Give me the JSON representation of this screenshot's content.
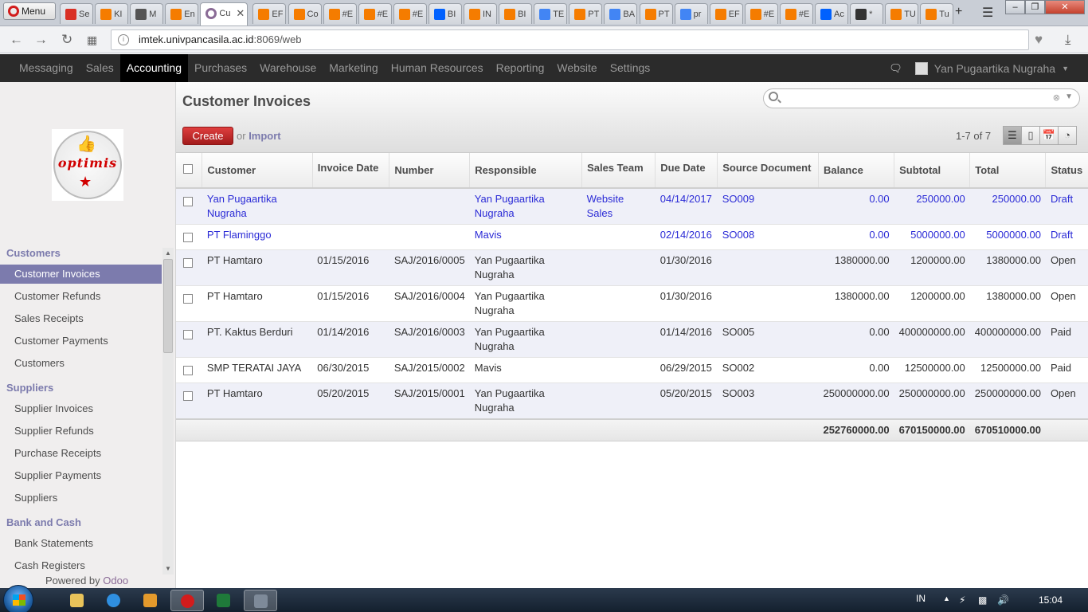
{
  "browser": {
    "menu_label": "Menu",
    "tabs": [
      {
        "label": "Se",
        "color": "#d93025"
      },
      {
        "label": "KI",
        "color": "#f57c00"
      },
      {
        "label": "M",
        "color": "#555555"
      },
      {
        "label": "En",
        "color": "#f57c00"
      },
      {
        "label": "Cu",
        "color": "#8a6b96"
      },
      {
        "label": "EF",
        "color": "#f57c00"
      },
      {
        "label": "Co",
        "color": "#f57c00"
      },
      {
        "label": "#E",
        "color": "#f57c00"
      },
      {
        "label": "#E",
        "color": "#f57c00"
      },
      {
        "label": "#E",
        "color": "#f57c00"
      },
      {
        "label": "BI",
        "color": "#0061fe"
      },
      {
        "label": "IN",
        "color": "#f57c00"
      },
      {
        "label": "BI",
        "color": "#f57c00"
      },
      {
        "label": "TE",
        "color": "#4285f4"
      },
      {
        "label": "PT",
        "color": "#f57c00"
      },
      {
        "label": "BA",
        "color": "#4285f4"
      },
      {
        "label": "PT",
        "color": "#f57c00"
      },
      {
        "label": "pr",
        "color": "#4285f4"
      },
      {
        "label": "EF",
        "color": "#f57c00"
      },
      {
        "label": "#E",
        "color": "#f57c00"
      },
      {
        "label": "#E",
        "color": "#f57c00"
      },
      {
        "label": "Ac",
        "color": "#0061fe"
      },
      {
        "label": "*",
        "color": "#333333"
      },
      {
        "label": "TU",
        "color": "#f57c00"
      },
      {
        "label": "Tu",
        "color": "#f57c00"
      }
    ],
    "url_host": "imtek.univpancasila.ac.id",
    "url_rest": ":8069/web"
  },
  "topnav": {
    "items": [
      "Messaging",
      "Sales",
      "Accounting",
      "Purchases",
      "Warehouse",
      "Marketing",
      "Human Resources",
      "Reporting",
      "Website",
      "Settings"
    ],
    "active": "Accounting",
    "user_name": "Yan Pugaartika Nugraha"
  },
  "sidebar": {
    "sections": [
      {
        "title": "Customers",
        "items": [
          "Customer Invoices",
          "Customer Refunds",
          "Sales Receipts",
          "Customer Payments",
          "Customers"
        ]
      },
      {
        "title": "Suppliers",
        "items": [
          "Supplier Invoices",
          "Supplier Refunds",
          "Purchase Receipts",
          "Supplier Payments",
          "Suppliers"
        ]
      },
      {
        "title": "Bank and Cash",
        "items": [
          "Bank Statements",
          "Cash Registers"
        ]
      }
    ],
    "active_item": "Customer Invoices",
    "powered_by": "Powered by",
    "powered_brand": "Odoo"
  },
  "main": {
    "title": "Customer Invoices",
    "search_placeholder": "",
    "create_label": "Create",
    "or_label": "or",
    "import_label": "Import",
    "pager": "1-7 of 7",
    "columns": [
      "Customer",
      "Invoice Date",
      "Number",
      "Responsible",
      "Sales Team",
      "Due Date",
      "Source Document",
      "Balance",
      "Subtotal",
      "Total",
      "Status"
    ],
    "rows": [
      {
        "customer": "Yan Pugaartika Nugraha",
        "invoice_date": "",
        "number": "",
        "responsible": "Yan Pugaartika Nugraha",
        "sales_team": "Website Sales",
        "due_date": "04/14/2017",
        "source": "SO009",
        "balance": "0.00",
        "subtotal": "250000.00",
        "total": "250000.00",
        "status": "Draft"
      },
      {
        "customer": "PT Flaminggo",
        "invoice_date": "",
        "number": "",
        "responsible": "Mavis",
        "sales_team": "",
        "due_date": "02/14/2016",
        "source": "SO008",
        "balance": "0.00",
        "subtotal": "5000000.00",
        "total": "5000000.00",
        "status": "Draft"
      },
      {
        "customer": "PT Hamtaro",
        "invoice_date": "01/15/2016",
        "number": "SAJ/2016/0005",
        "responsible": "Yan Pugaartika Nugraha",
        "sales_team": "",
        "due_date": "01/30/2016",
        "source": "",
        "balance": "1380000.00",
        "subtotal": "1200000.00",
        "total": "1380000.00",
        "status": "Open"
      },
      {
        "customer": "PT Hamtaro",
        "invoice_date": "01/15/2016",
        "number": "SAJ/2016/0004",
        "responsible": "Yan Pugaartika Nugraha",
        "sales_team": "",
        "due_date": "01/30/2016",
        "source": "",
        "balance": "1380000.00",
        "subtotal": "1200000.00",
        "total": "1380000.00",
        "status": "Open"
      },
      {
        "customer": "PT. Kaktus Berduri",
        "invoice_date": "01/14/2016",
        "number": "SAJ/2016/0003",
        "responsible": "Yan Pugaartika Nugraha",
        "sales_team": "",
        "due_date": "01/14/2016",
        "source": "SO005",
        "balance": "0.00",
        "subtotal": "400000000.00",
        "total": "400000000.00",
        "status": "Paid"
      },
      {
        "customer": "SMP TERATAI JAYA",
        "invoice_date": "06/30/2015",
        "number": "SAJ/2015/0002",
        "responsible": "Mavis",
        "sales_team": "",
        "due_date": "06/29/2015",
        "source": "SO002",
        "balance": "0.00",
        "subtotal": "12500000.00",
        "total": "12500000.00",
        "status": "Paid"
      },
      {
        "customer": "PT Hamtaro",
        "invoice_date": "05/20/2015",
        "number": "SAJ/2015/0001",
        "responsible": "Yan Pugaartika Nugraha",
        "sales_team": "",
        "due_date": "05/20/2015",
        "source": "SO003",
        "balance": "250000000.00",
        "subtotal": "250000000.00",
        "total": "250000000.00",
        "status": "Open"
      }
    ],
    "totals": {
      "balance": "252760000.00",
      "subtotal": "670150000.00",
      "total": "670510000.00"
    }
  },
  "taskbar": {
    "lang": "IN",
    "clock": "15:04"
  }
}
